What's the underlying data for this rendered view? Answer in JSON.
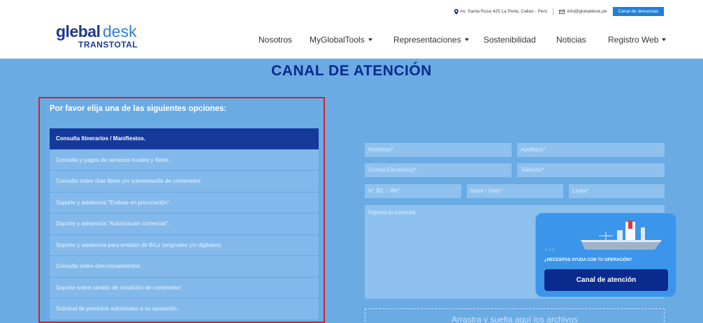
{
  "topbar": {
    "address": "Av. Santa Rosa 425 La Perla, Callao - Perú",
    "email": "info@globaldesk.pe",
    "report_button": "Canal de denuncias"
  },
  "logo": {
    "part1": "glebal",
    "part2": "desk",
    "sub": "TRANSTOTAL"
  },
  "nav": {
    "items": [
      {
        "label": "Nosotros"
      },
      {
        "label": "MyGlobalTools"
      },
      {
        "label": "Representaciones"
      },
      {
        "label": "Sostenibilidad"
      },
      {
        "label": "Noticias"
      },
      {
        "label": "Registro Web"
      }
    ]
  },
  "page_title": "CANAL DE ATENCIÓN",
  "options": {
    "header": "Por favor elija una de las siguientes opciones:",
    "items": [
      "Consulta Itinerarios / Manifiestos.",
      "Consulta y pagos de servicios locales y fletes.",
      "Consulta sobre días libres y/o sobreestadía de contenedor.",
      "Soporte y asistencia \"Endose en procuración\".",
      "Soporte y asistencia \"Autorizacion comercial\".",
      "Soporte y asistencia para emisión de B/Ls (originales y/o digitales).",
      "Consulta sobre direccionamientos.",
      "Soporte sobre cambio de condición de contenedor.",
      "Solicitud de precintos adicionales a su operación."
    ]
  },
  "form": {
    "nombres": "Nombres*",
    "apellidos": "Apellidos*",
    "correo": "Correo Electrónico*",
    "telefono": "Teléfono*",
    "bl": "N° B/L – BK*",
    "nave": "Nave / Viaje*",
    "linea": "Línea*",
    "consulta": "Ingresa tu consulta",
    "drop": "Arrastra y suelta aquí los archivos"
  },
  "help_card": {
    "question": "¿NECESITAS AYUDA CON TU OPERACIÓN?",
    "button": "Canal de atención"
  },
  "colors": {
    "page_bg": "#6aabe4",
    "brand_dark": "#0b2a8e",
    "accent": "#1f7fd6",
    "highlight_border": "#d62020"
  }
}
